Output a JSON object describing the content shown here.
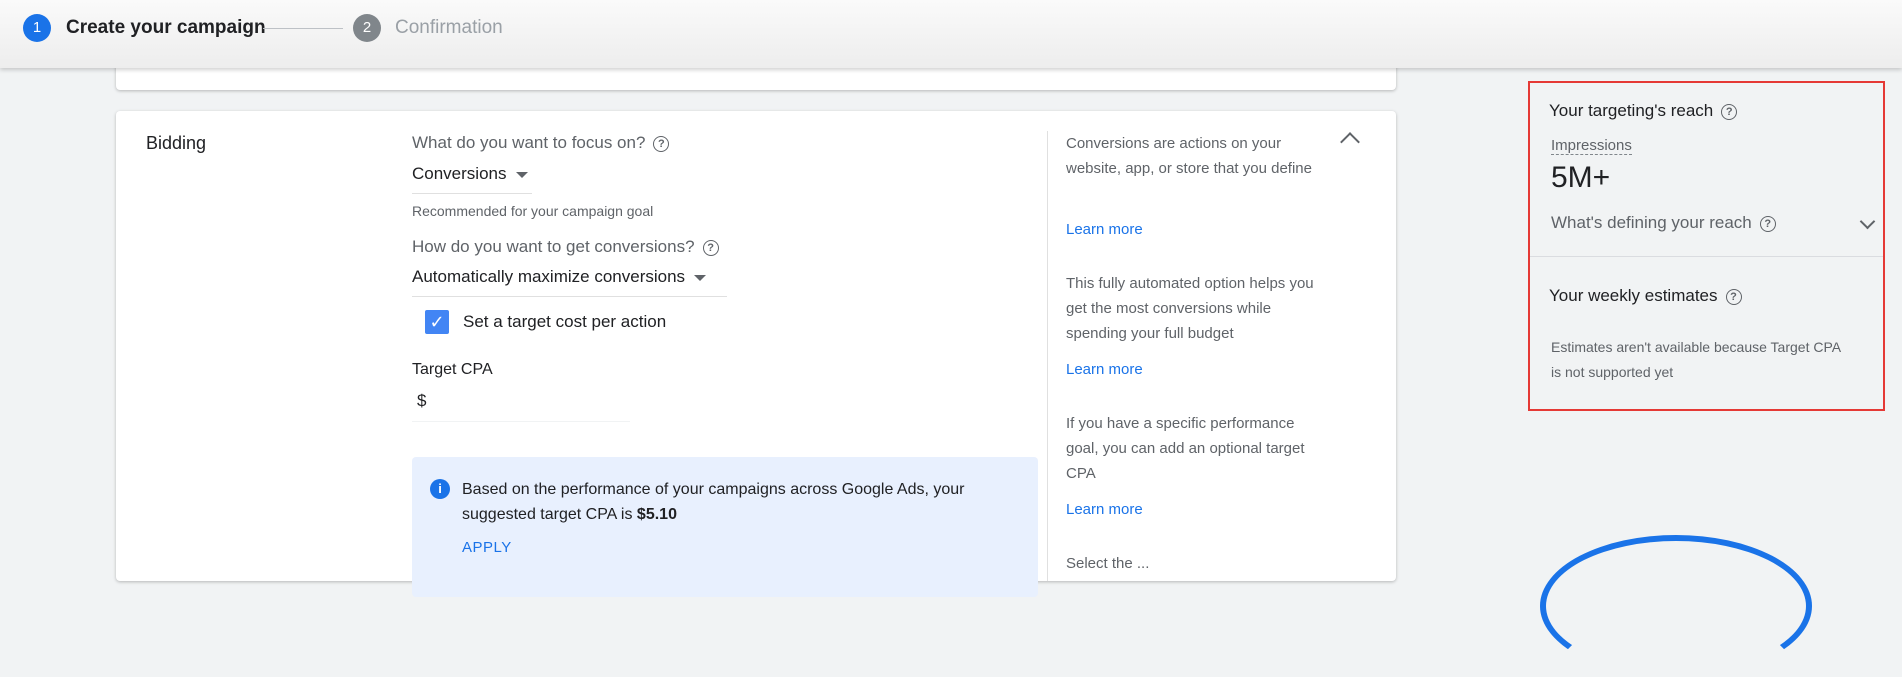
{
  "stepper": {
    "step1_number": "1",
    "step1_label": "Create your campaign",
    "step2_number": "2",
    "step2_label": "Confirmation"
  },
  "bidding": {
    "section_title": "Bidding",
    "focus_question": "What do you want to focus on?",
    "focus_value": "Conversions",
    "focus_hint": "Recommended for your campaign goal",
    "conversions_question": "How do you want to get conversions?",
    "conversions_value": "Automatically maximize conversions",
    "target_cost_checkbox_label": "Set a target cost per action",
    "target_cost_checked": true,
    "target_cpa_label": "Target CPA",
    "currency_symbol": "$",
    "suggestion_text": "Based on the performance of your campaigns across Google Ads, your suggested target CPA is ",
    "suggestion_value": "$5.10",
    "apply_label": "APPLY"
  },
  "help": {
    "conversions_text": "Conversions are actions on your website, app, or store that you define",
    "learn_more_1": "Learn more",
    "automated_text": "This fully automated option helps you get the most conversions while spending your full budget",
    "learn_more_2": "Learn more",
    "target_cpa_text": "If you have a specific performance goal, you can add an optional target CPA",
    "learn_more_3": "Learn more",
    "cut_off_text": "Select the ..."
  },
  "reach": {
    "title": "Your targeting's reach",
    "impressions_label": "Impressions",
    "impressions_value": "5M+",
    "defining_label": "What's defining your reach",
    "weekly_title": "Your weekly estimates",
    "weekly_note": "Estimates aren't available because Target CPA is not supported yet"
  },
  "colors": {
    "accent": "#1a73e8",
    "highlight_border": "#e53935"
  }
}
